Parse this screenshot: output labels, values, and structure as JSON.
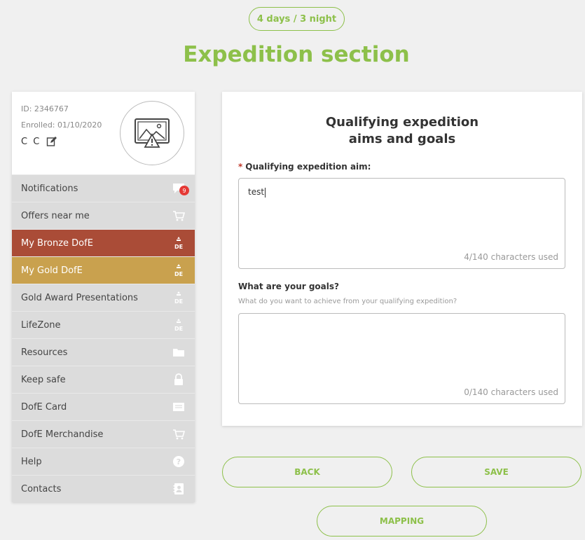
{
  "header": {
    "duration_label": "4 days / 3 night",
    "title": "Expedition section"
  },
  "profile": {
    "id_text": "ID: 2346767",
    "enrolled_text": "Enrolled: 01/10/2020",
    "name": "C C"
  },
  "sidebar": {
    "items": [
      {
        "label": "Notifications",
        "icon": "chat-icon",
        "badge": "9"
      },
      {
        "label": "Offers near me",
        "icon": "cart-icon"
      },
      {
        "label": "My Bronze DofE",
        "icon": "dofe-logo-icon"
      },
      {
        "label": "My Gold DofE",
        "icon": "dofe-logo-icon"
      },
      {
        "label": "Gold Award Presentations",
        "icon": "dofe-logo-icon"
      },
      {
        "label": "LifeZone",
        "icon": "dofe-logo-icon"
      },
      {
        "label": "Resources",
        "icon": "folder-icon"
      },
      {
        "label": "Keep safe",
        "icon": "lock-icon"
      },
      {
        "label": "DofE Card",
        "icon": "card-icon"
      },
      {
        "label": "DofE Merchandise",
        "icon": "cart-icon"
      },
      {
        "label": "Help",
        "icon": "help-icon"
      },
      {
        "label": "Contacts",
        "icon": "contacts-icon"
      }
    ],
    "colors": {
      "bronze": "#aa4c37",
      "gold": "#c9a14e",
      "default": "#dcdcdc"
    }
  },
  "form": {
    "title_line1": "Qualifying expedition",
    "title_line2": "aims and goals",
    "aim_label": "Qualifying expedition aim:",
    "aim_value": "test",
    "aim_counter": "4/140 characters used",
    "goals_label": "What are your goals?",
    "goals_hint": "What do you want to achieve from your qualifying expedition?",
    "goals_value": "",
    "goals_counter": "0/140 characters used"
  },
  "actions": {
    "back_label": "BACK",
    "save_label": "SAVE",
    "mapping_label": "MAPPING"
  },
  "theme": {
    "accent": "#8dc04a"
  }
}
